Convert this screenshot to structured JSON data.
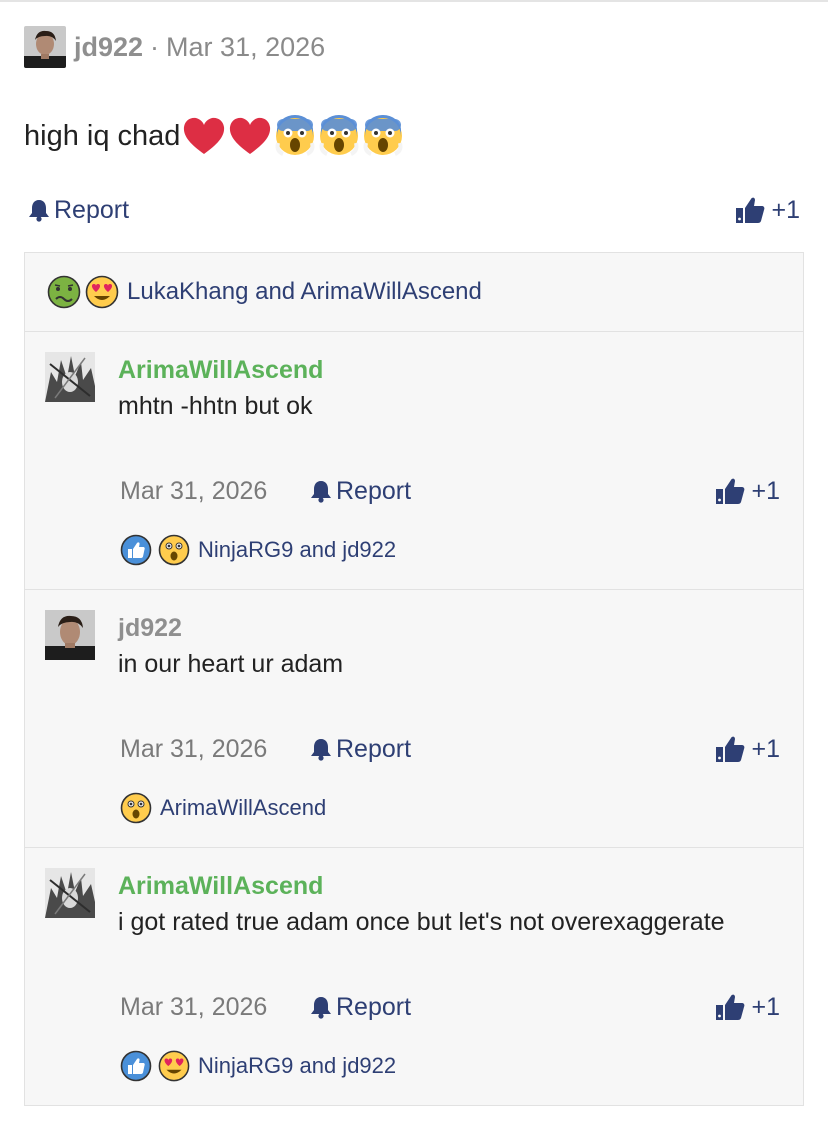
{
  "post": {
    "username": "jd922",
    "separator": "·",
    "date": "Mar 31, 2026",
    "text": "high iq chad",
    "emojis": [
      "heart",
      "heart",
      "scream",
      "scream",
      "scream"
    ],
    "report_label": "Report",
    "like_count": "+1"
  },
  "thread": {
    "reactions": [
      "nauseated",
      "heart-eyes"
    ],
    "reactor_names": "LukaKhang and ArimaWillAscend",
    "replies": [
      {
        "username": "ArimaWillAscend",
        "name_color": "#5cb25a",
        "text": "mhtn -hhtn but ok",
        "date": "Mar 31, 2026",
        "report_label": "Report",
        "like_count": "+1",
        "reactions": [
          "like",
          "astonished"
        ],
        "reactor_names": "NinjaRG9 and jd922"
      },
      {
        "username": "jd922",
        "name_color": "#8f8f8f",
        "text": "in our heart ur adam",
        "date": "Mar 31, 2026",
        "report_label": "Report",
        "like_count": "+1",
        "reactions": [
          "astonished"
        ],
        "reactor_names": "ArimaWillAscend"
      },
      {
        "username": "ArimaWillAscend",
        "name_color": "#5cb25a",
        "text": "i got rated true adam once but let's not overexaggerate",
        "date": "Mar 31, 2026",
        "report_label": "Report",
        "like_count": "+1",
        "reactions": [
          "like",
          "heart-eyes"
        ],
        "reactor_names": "NinjaRG9 and jd922"
      }
    ]
  },
  "colors": {
    "link": "#2e3f74",
    "meta_grey": "#7a7a7a",
    "panel_bg": "#f7f7f7",
    "green_name": "#5cb25a"
  }
}
